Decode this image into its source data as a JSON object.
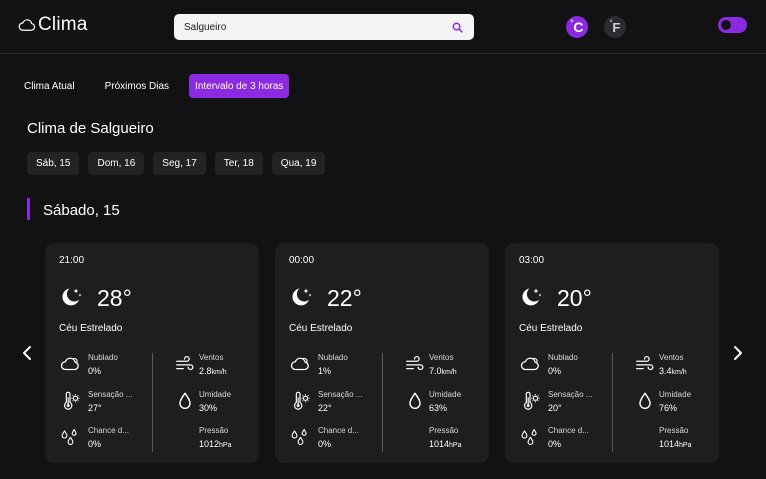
{
  "header": {
    "logo_text": "Clima",
    "search_value": "Salgueiro",
    "unit_c": "C",
    "unit_f": "F",
    "accent": "#8a2be2"
  },
  "tabs": [
    {
      "label": "Clima Atual",
      "active": false
    },
    {
      "label": "Próximos Dias",
      "active": false
    },
    {
      "label": "Intervalo de 3 horas",
      "active": true
    }
  ],
  "city_title": "Clima de Salgueiro",
  "days": [
    "Sáb, 15",
    "Dom, 16",
    "Seg, 17",
    "Ter, 18",
    "Qua, 19"
  ],
  "section_title": "Sábado, 15",
  "cards": [
    {
      "time": "21:00",
      "temp": "28°",
      "condition": "Céu Estrelado",
      "cloudy_label": "Nublado",
      "cloudy_value": "0%",
      "wind_label": "Ventos",
      "wind_value": "2.8",
      "wind_unit": "km/h",
      "feels_label": "Sensação ...",
      "feels_value": "27°",
      "humidity_label": "Umidade",
      "humidity_value": "30%",
      "rain_label": "Chance d...",
      "rain_value": "0%",
      "pressure_label": "Pressão",
      "pressure_value": "1012",
      "pressure_unit": "hPa"
    },
    {
      "time": "00:00",
      "temp": "22°",
      "condition": "Céu Estrelado",
      "cloudy_label": "Nublado",
      "cloudy_value": "1%",
      "wind_label": "Ventos",
      "wind_value": "7.0",
      "wind_unit": "km/h",
      "feels_label": "Sensação ...",
      "feels_value": "22°",
      "humidity_label": "Umidade",
      "humidity_value": "63%",
      "rain_label": "Chance d...",
      "rain_value": "0%",
      "pressure_label": "Pressão",
      "pressure_value": "1014",
      "pressure_unit": "hPa"
    },
    {
      "time": "03:00",
      "temp": "20°",
      "condition": "Céu Estrelado",
      "cloudy_label": "Nublado",
      "cloudy_value": "0%",
      "wind_label": "Ventos",
      "wind_value": "3.4",
      "wind_unit": "km/h",
      "feels_label": "Sensação ...",
      "feels_value": "20°",
      "humidity_label": "Umidade",
      "humidity_value": "76%",
      "rain_label": "Chance d...",
      "rain_value": "0%",
      "pressure_label": "Pressão",
      "pressure_value": "1014",
      "pressure_unit": "hPa"
    }
  ]
}
